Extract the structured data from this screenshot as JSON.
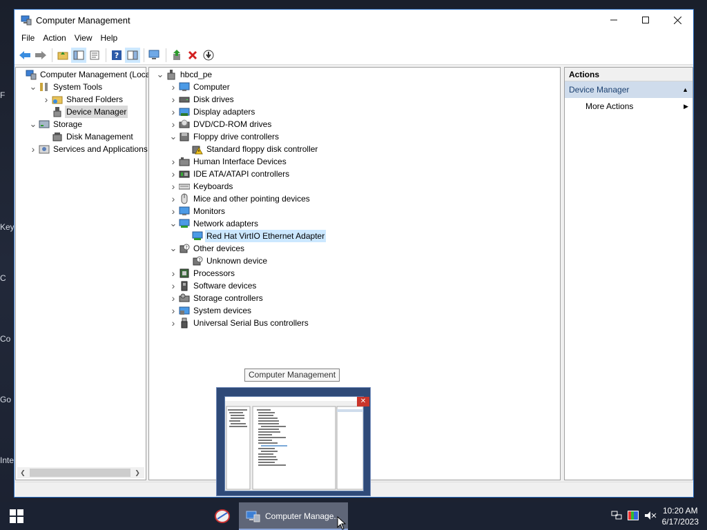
{
  "desktop": {
    "peek_labels": [
      "F",
      "Key",
      "C",
      "Co",
      "Go",
      "Inte"
    ]
  },
  "window": {
    "title": "Computer Management",
    "menu": [
      "File",
      "Action",
      "View",
      "Help"
    ]
  },
  "left_tree": [
    {
      "label": "Computer Management (Local",
      "depth": 0,
      "chevron": "",
      "icon": "computer-management-icon"
    },
    {
      "label": "System Tools",
      "depth": 1,
      "chevron": "down",
      "icon": "tools-icon"
    },
    {
      "label": "Shared Folders",
      "depth": 2,
      "chevron": "right",
      "icon": "shared-folder-icon"
    },
    {
      "label": "Device Manager",
      "depth": 2,
      "chevron": "",
      "icon": "device-manager-icon",
      "selected": true
    },
    {
      "label": "Storage",
      "depth": 1,
      "chevron": "down",
      "icon": "storage-icon"
    },
    {
      "label": "Disk Management",
      "depth": 2,
      "chevron": "",
      "icon": "disk-management-icon"
    },
    {
      "label": "Services and Applications",
      "depth": 1,
      "chevron": "right",
      "icon": "services-icon"
    }
  ],
  "device_tree": [
    {
      "label": "hbcd_pe",
      "depth": 0,
      "chevron": "down",
      "icon": "computer-root-icon"
    },
    {
      "label": "Computer",
      "depth": 1,
      "chevron": "right",
      "icon": "monitor-icon"
    },
    {
      "label": "Disk drives",
      "depth": 1,
      "chevron": "right",
      "icon": "disk-drive-icon"
    },
    {
      "label": "Display adapters",
      "depth": 1,
      "chevron": "right",
      "icon": "display-adapter-icon"
    },
    {
      "label": "DVD/CD-ROM drives",
      "depth": 1,
      "chevron": "right",
      "icon": "dvd-icon"
    },
    {
      "label": "Floppy drive controllers",
      "depth": 1,
      "chevron": "down",
      "icon": "floppy-controller-icon"
    },
    {
      "label": "Standard floppy disk controller",
      "depth": 2,
      "chevron": "",
      "icon": "warning-device-icon"
    },
    {
      "label": "Human Interface Devices",
      "depth": 1,
      "chevron": "right",
      "icon": "hid-icon"
    },
    {
      "label": "IDE ATA/ATAPI controllers",
      "depth": 1,
      "chevron": "right",
      "icon": "ide-controller-icon"
    },
    {
      "label": "Keyboards",
      "depth": 1,
      "chevron": "right",
      "icon": "keyboard-icon"
    },
    {
      "label": "Mice and other pointing devices",
      "depth": 1,
      "chevron": "right",
      "icon": "mouse-icon"
    },
    {
      "label": "Monitors",
      "depth": 1,
      "chevron": "right",
      "icon": "monitor-icon"
    },
    {
      "label": "Network adapters",
      "depth": 1,
      "chevron": "down",
      "icon": "network-adapter-icon"
    },
    {
      "label": "Red Hat VirtIO Ethernet Adapter",
      "depth": 2,
      "chevron": "",
      "icon": "network-adapter-icon",
      "selected": true
    },
    {
      "label": "Other devices",
      "depth": 1,
      "chevron": "down",
      "icon": "unknown-device-icon"
    },
    {
      "label": "Unknown device",
      "depth": 2,
      "chevron": "",
      "icon": "unknown-device-icon"
    },
    {
      "label": "Processors",
      "depth": 1,
      "chevron": "right",
      "icon": "processor-icon"
    },
    {
      "label": "Software devices",
      "depth": 1,
      "chevron": "right",
      "icon": "software-device-icon"
    },
    {
      "label": "Storage controllers",
      "depth": 1,
      "chevron": "right",
      "icon": "storage-controller-icon"
    },
    {
      "label": "System devices",
      "depth": 1,
      "chevron": "right",
      "icon": "system-device-icon"
    },
    {
      "label": "Universal Serial Bus controllers",
      "depth": 1,
      "chevron": "right",
      "icon": "usb-icon"
    }
  ],
  "actions": {
    "header": "Actions",
    "section": "Device Manager",
    "items": [
      "More Actions"
    ]
  },
  "taskbar": {
    "active_app_label": "Computer Manage...",
    "tooltip": "Computer Management",
    "time": "10:20 AM",
    "date": "6/17/2023"
  },
  "colors": {
    "title_border": "#2b6fc4",
    "selection": "#cce8ff",
    "actions_section": "#cfdcec",
    "taskbar": "#1b2232",
    "delete_red": "#d22020"
  }
}
